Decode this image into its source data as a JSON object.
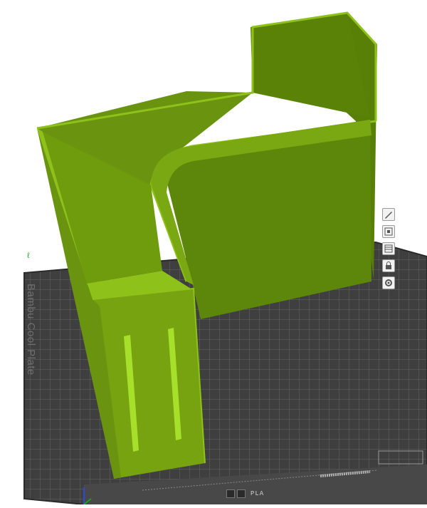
{
  "scene": {
    "background": "#ffffff",
    "bed_color": "#4a4a4a",
    "bed_grid_color": "#6b6b6b",
    "model_color": "#76a30f",
    "model_dark": "#587f06",
    "model_light": "#8ec21a",
    "bed_label": "Bambu Cool Plate"
  },
  "plate_bar": {
    "filament_label": "PLA",
    "icons": [
      "grid-icon",
      "gear-icon"
    ]
  },
  "side_tools": [
    "pencil-icon",
    "arrange-icon",
    "layers-icon",
    "lock-icon",
    "settings-icon"
  ],
  "marker_glyph": "ℓ"
}
